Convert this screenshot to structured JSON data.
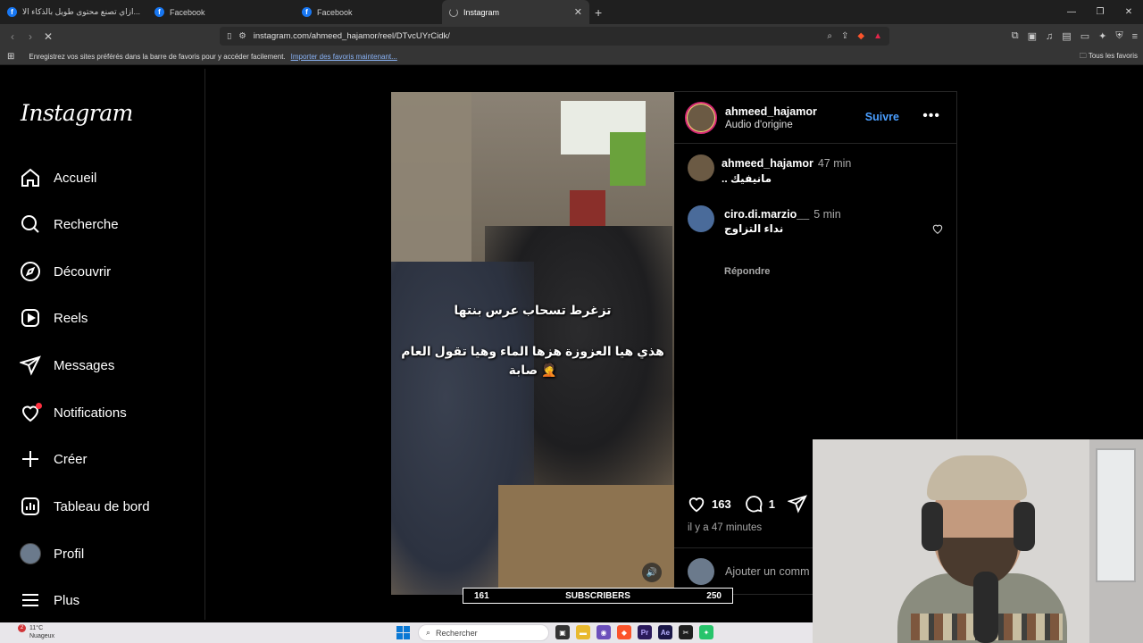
{
  "browser": {
    "tabs": [
      {
        "label": "ازاي تصنع محتوى طويل بالذكاء الا..."
      },
      {
        "label": "Facebook"
      },
      {
        "label": "Facebook"
      },
      {
        "label": "Instagram"
      }
    ],
    "url": "instagram.com/ahmeed_hajamor/reel/DTvcUYrCidk/",
    "bookmarks_prompt": "Enregistrez vos sites préférés dans la barre de favoris pour y accéder facilement.",
    "bookmarks_link": "Importer des favoris maintenant...",
    "all_favorites": "Tous les favoris"
  },
  "sidebar": {
    "logo": "Instagram",
    "items": [
      {
        "label": "Accueil",
        "icon": "home-icon"
      },
      {
        "label": "Recherche",
        "icon": "search-icon"
      },
      {
        "label": "Découvrir",
        "icon": "compass-icon"
      },
      {
        "label": "Reels",
        "icon": "reels-icon"
      },
      {
        "label": "Messages",
        "icon": "send-icon"
      },
      {
        "label": "Notifications",
        "icon": "heart-icon"
      },
      {
        "label": "Créer",
        "icon": "plus-icon"
      },
      {
        "label": "Tableau de bord",
        "icon": "dashboard-icon"
      },
      {
        "label": "Profil",
        "icon": "avatar"
      },
      {
        "label": "Plus",
        "icon": "menu-icon"
      }
    ]
  },
  "post": {
    "caption_line1": "تزغرط تسحاب عرس بنتها",
    "caption_line2": "هذي هيا العزوزة هزها الماء وهيا تقول العام",
    "caption_line3": "صابة 🤦",
    "author": "ahmeed_hajamor",
    "audio": "Audio d'origine",
    "follow_label": "Suivre",
    "comments": [
      {
        "user": "ahmeed_hajamor",
        "time": "47 min",
        "text": "مانيفيك .."
      },
      {
        "user": "ciro.di.marzio__",
        "time": "5 min",
        "text": "نداء التزاوج",
        "reply": "Répondre"
      }
    ],
    "likes": "163",
    "comment_count": "1",
    "posted_ago": "il y a 47 minutes",
    "comment_placeholder": "Ajouter un comm"
  },
  "subscribers_bar": {
    "left": "161",
    "label": "SUBSCRIBERS",
    "right": "250"
  },
  "taskbar": {
    "weather_badge": "2",
    "weather_temp": "11°C",
    "weather_desc": "Nuageux",
    "search_placeholder": "Rechercher"
  },
  "colors": {
    "accent": "#4a9eff",
    "notif": "#ff3040",
    "background": "#000000"
  }
}
